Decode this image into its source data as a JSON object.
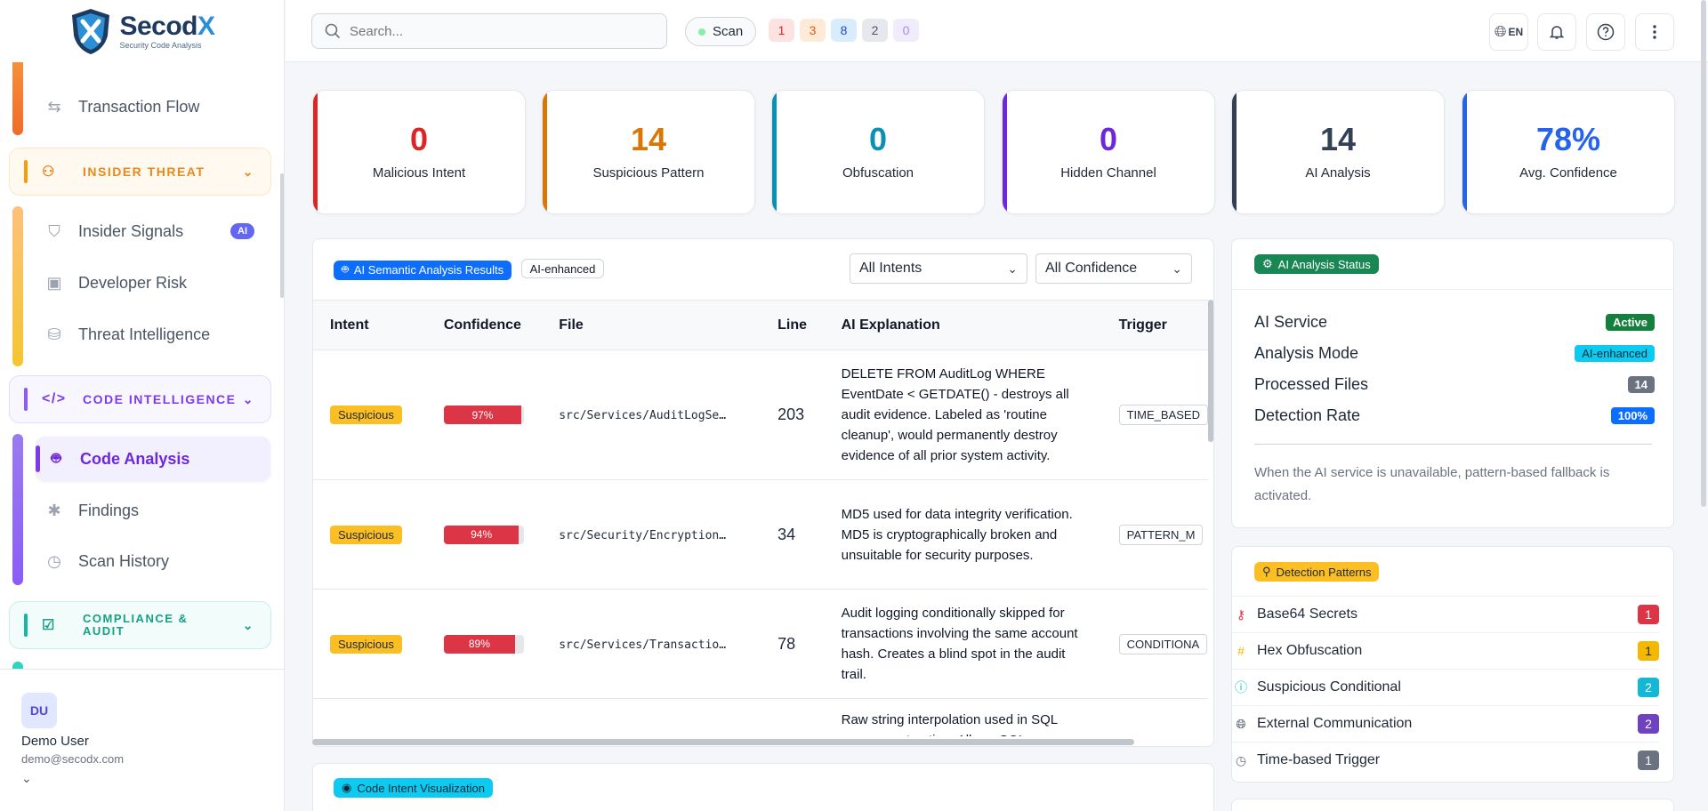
{
  "brand": {
    "name_prefix": "Secod",
    "name_suffix": "X",
    "tagline": "Security Code Analysis"
  },
  "sidebar": {
    "items_top": [
      {
        "label": "Transaction Flow",
        "icon": "arrows-swap-icon"
      }
    ],
    "groups": [
      {
        "label": "INSIDER THREAT",
        "color": "#e8891a"
      },
      {
        "label": "CODE INTELLIGENCE",
        "color": "#7c3aed"
      },
      {
        "label": "COMPLIANCE & AUDIT",
        "color": "#16a085"
      }
    ],
    "insider_items": [
      {
        "label": "Insider Signals",
        "badge": "AI"
      },
      {
        "label": "Developer Risk"
      },
      {
        "label": "Threat Intelligence"
      }
    ],
    "code_items": [
      {
        "label": "Code Analysis"
      },
      {
        "label": "Findings"
      },
      {
        "label": "Scan History"
      }
    ]
  },
  "user": {
    "initials": "DU",
    "name": "Demo User",
    "email": "demo@secodx.com"
  },
  "topbar": {
    "search_placeholder": "Search...",
    "scan_label": "Scan",
    "counts": [
      {
        "value": "1",
        "bg": "#fde2e2",
        "fg": "#dc2626"
      },
      {
        "value": "3",
        "bg": "#fdebd8",
        "fg": "#ea580c"
      },
      {
        "value": "8",
        "bg": "#d9ecfb",
        "fg": "#1d4ed8"
      },
      {
        "value": "2",
        "bg": "#e6e8ee",
        "fg": "#4b5563"
      },
      {
        "value": "0",
        "bg": "#f1ecfc",
        "fg": "#a78bfa"
      }
    ],
    "lang": "EN"
  },
  "stats": [
    {
      "value": "0",
      "label": "Malicious Intent",
      "color": "#dc2626"
    },
    {
      "value": "14",
      "label": "Suspicious Pattern",
      "color": "#d97706"
    },
    {
      "value": "0",
      "label": "Obfuscation",
      "color": "#0891b2"
    },
    {
      "value": "0",
      "label": "Hidden Channel",
      "color": "#6d28d9"
    },
    {
      "value": "14",
      "label": "AI Analysis",
      "color": "#334155"
    },
    {
      "value": "78%",
      "label": "Avg. Confidence",
      "color": "#2563eb"
    }
  ],
  "results": {
    "title": "AI Semantic Analysis Results",
    "mode_badge": "AI-enhanced",
    "filter_intent": "All Intents",
    "filter_confidence": "All Confidence",
    "columns": [
      "Intent",
      "Confidence",
      "File",
      "Line",
      "AI Explanation",
      "Trigger"
    ],
    "rows": [
      {
        "intent": "Suspicious",
        "confidence": 97,
        "confidence_label": "97%",
        "file": "src/Services/AuditLogSe…",
        "line": "203",
        "explanation": "DELETE FROM AuditLog WHERE EventDate < GETDATE() - destroys all audit evidence. Labeled as 'routine cleanup', would permanently destroy evidence of all prior system activity.",
        "trigger": "TIME_BASED"
      },
      {
        "intent": "Suspicious",
        "confidence": 94,
        "confidence_label": "94%",
        "file": "src/Security/Encryption…",
        "line": "34",
        "explanation": "MD5 used for data integrity verification. MD5 is cryptographically broken and unsuitable for security purposes.",
        "trigger": "PATTERN_M"
      },
      {
        "intent": "Suspicious",
        "confidence": 89,
        "confidence_label": "89%",
        "file": "src/Services/Transactio…",
        "line": "78",
        "explanation": "Audit logging conditionally skipped for transactions involving the same account hash. Creates a blind spot in the audit trail.",
        "trigger": "CONDITIONA"
      },
      {
        "intent": "",
        "confidence": null,
        "confidence_label": "",
        "file": "",
        "line": "",
        "explanation": "Raw string interpolation used in SQL query construction. Allows SQL",
        "trigger": ""
      }
    ]
  },
  "visualization": {
    "title": "Code Intent Visualization"
  },
  "ai_status": {
    "title": "AI Analysis Status",
    "rows": [
      {
        "label": "AI Service",
        "value": "Active",
        "color": "#15803d"
      },
      {
        "label": "Analysis Mode",
        "value": "AI-enhanced",
        "color": "#0ea5c6"
      },
      {
        "label": "Processed Files",
        "value": "14",
        "color": "#6b7280"
      },
      {
        "label": "Detection Rate",
        "value": "100%",
        "color": "#0d6efd"
      }
    ],
    "note": "When the AI service is unavailable, pattern-based fallback is activated."
  },
  "patterns": {
    "title": "Detection Patterns",
    "rows": [
      {
        "label": "Base64 Secrets",
        "count": "1",
        "icon": "key-icon",
        "color": "#dc3545"
      },
      {
        "label": "Hex Obfuscation",
        "count": "1",
        "icon": "hash-icon",
        "color": "#f5b800"
      },
      {
        "label": "Suspicious Conditional",
        "count": "2",
        "icon": "question-icon",
        "color": "#14b8d4"
      },
      {
        "label": "External Communication",
        "count": "2",
        "icon": "globe-icon",
        "color": "#6f42c1"
      },
      {
        "label": "Time-based Trigger",
        "count": "1",
        "icon": "clock-icon",
        "color": "#6b7280"
      }
    ]
  }
}
